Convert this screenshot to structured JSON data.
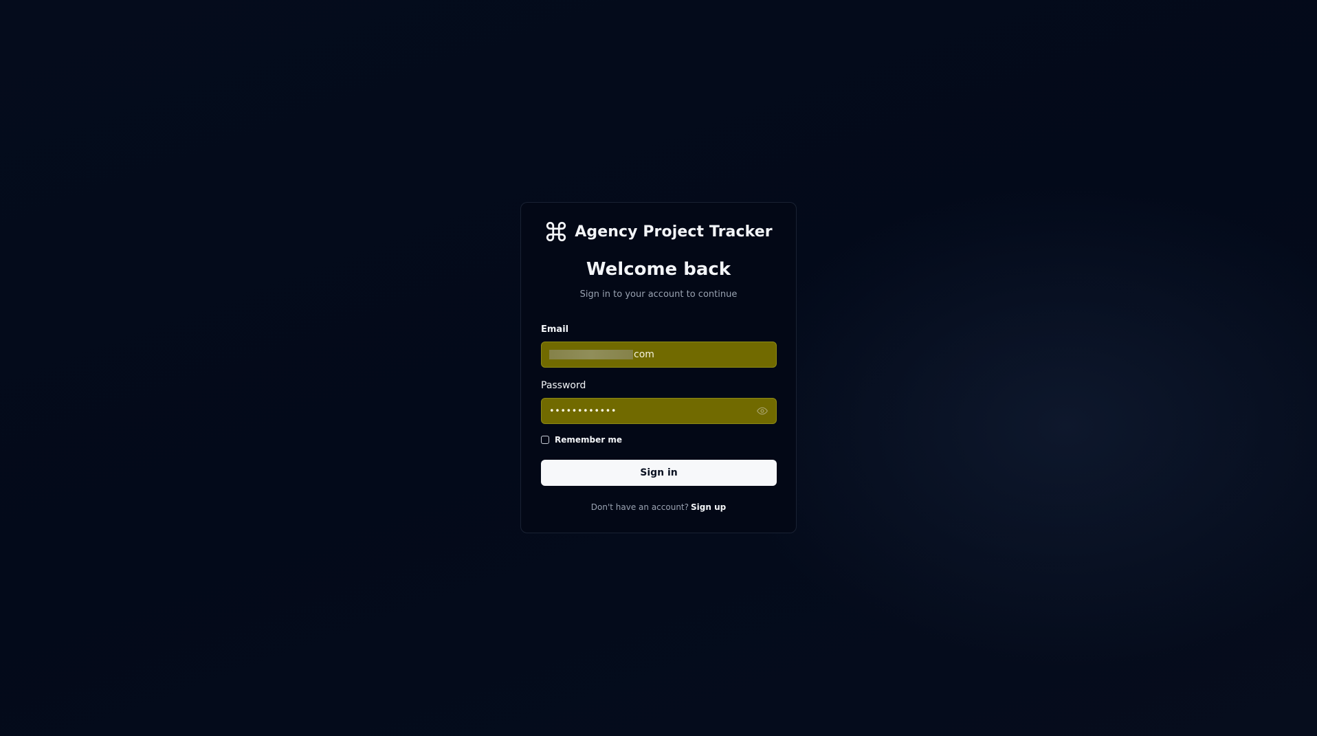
{
  "app": {
    "name": "Agency Project Tracker",
    "logo_icon": "command-icon"
  },
  "login": {
    "heading": "Welcome back",
    "subheading": "Sign in to your account to continue",
    "email": {
      "label": "Email",
      "value_visible_suffix": "com"
    },
    "password": {
      "label": "Password",
      "masked_value": "••••••••••••",
      "toggle_icon": "eye-icon"
    },
    "remember_me": {
      "label": "Remember me",
      "checked": false
    },
    "submit_label": "Sign in",
    "footer": {
      "prompt": "Don't have an account?",
      "signup_label": "Sign up"
    }
  },
  "colors": {
    "background": "#040b1b",
    "card": "#030816",
    "autofill_field": "#716a00",
    "button": "#f7f8fa",
    "text_primary": "#f3f5f8",
    "text_muted": "#9aa3b2"
  }
}
